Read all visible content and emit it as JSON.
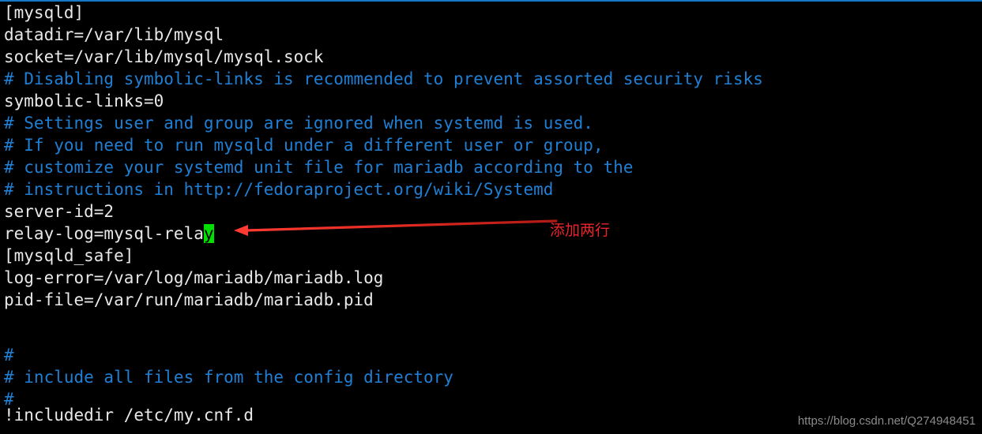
{
  "window": {
    "kind": "terminal-text-editor",
    "background_color": "#000000",
    "top_rule_color": "#1878c8",
    "foreground_color": "#e8e8e8",
    "comment_color": "#1f7fd4",
    "cursor_background_color": "#00e000",
    "cursor_foreground_color": "#000000",
    "annotation_color": "#e8252b",
    "watermark_color": "#8b8b8b"
  },
  "file": {
    "lines": [
      {
        "id": "l01",
        "text": "[mysqld]",
        "type": "config"
      },
      {
        "id": "l02",
        "text": "datadir=/var/lib/mysql",
        "type": "config"
      },
      {
        "id": "l03",
        "text": "socket=/var/lib/mysql/mysql.sock",
        "type": "config"
      },
      {
        "id": "l04",
        "text": "# Disabling symbolic-links is recommended to prevent assorted security risks",
        "type": "comment"
      },
      {
        "id": "l05",
        "text": "symbolic-links=0",
        "type": "config"
      },
      {
        "id": "l06",
        "text": "# Settings user and group are ignored when systemd is used.",
        "type": "comment"
      },
      {
        "id": "l07",
        "text": "# If you need to run mysqld under a different user or group,",
        "type": "comment"
      },
      {
        "id": "l08",
        "text": "# customize your systemd unit file for mariadb according to the",
        "type": "comment"
      },
      {
        "id": "l09",
        "text": "# instructions in http://fedoraproject.org/wiki/Systemd",
        "type": "comment"
      },
      {
        "id": "l10",
        "text": "server-id=2",
        "type": "config"
      },
      {
        "id": "l11",
        "text": "relay-log=mysql-rela",
        "cursor_char": "y",
        "type": "config-with-cursor"
      },
      {
        "id": "l12",
        "text": "[mysqld_safe]",
        "type": "config"
      },
      {
        "id": "l13",
        "text": "log-error=/var/log/mariadb/mariadb.log",
        "type": "config"
      },
      {
        "id": "l14",
        "text": "pid-file=/var/run/mariadb/mariadb.pid",
        "type": "config"
      },
      {
        "id": "l15",
        "text": "",
        "type": "blank"
      },
      {
        "id": "l16",
        "text": "",
        "type": "blank"
      },
      {
        "id": "l17",
        "text": "#",
        "type": "comment"
      },
      {
        "id": "l18",
        "text": "# include all files from the config directory",
        "type": "comment"
      },
      {
        "id": "l19",
        "text": "#",
        "type": "comment"
      },
      {
        "id": "l20",
        "text": "!includedir /etc/my.cnf.d",
        "type": "config"
      }
    ]
  },
  "annotation": {
    "label": "添加两行",
    "arrow_direction": "left",
    "points_to_line_id": "l11"
  },
  "watermark": {
    "text": "https://blog.csdn.net/Q274948451"
  }
}
